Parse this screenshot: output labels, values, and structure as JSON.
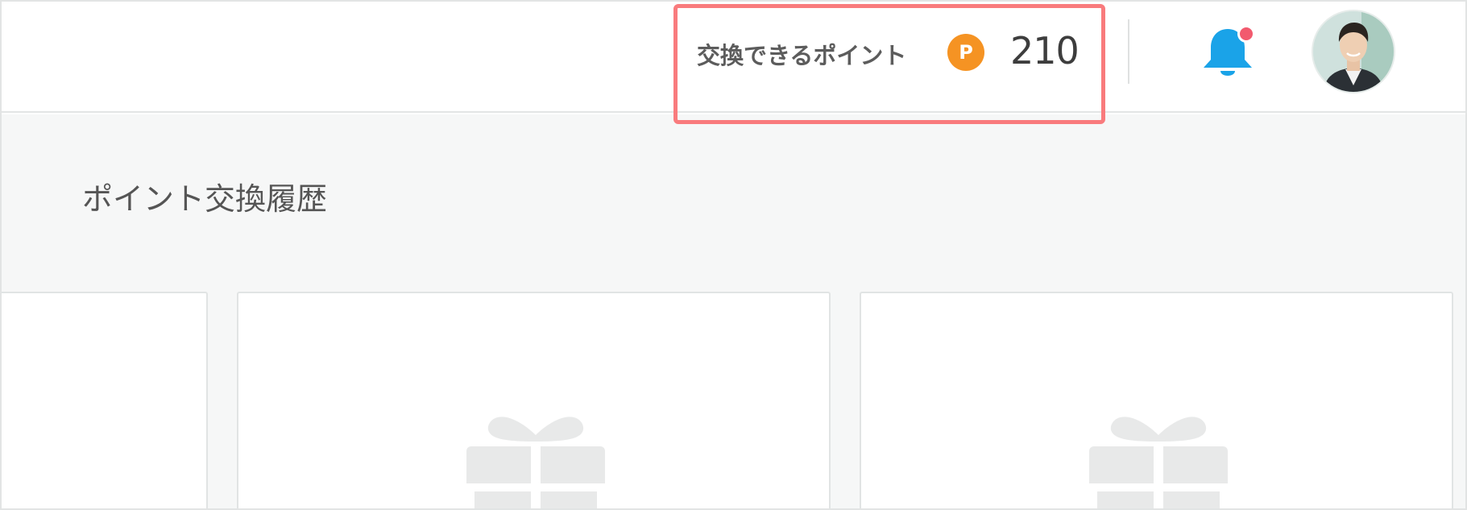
{
  "header": {
    "points_label": "交換できるポイント",
    "points_badge": "P",
    "points_value": "210",
    "notification_icon": "bell-icon",
    "avatar_alt": "user avatar"
  },
  "page": {
    "title": "ポイント交換履歴"
  },
  "cards": [
    {
      "icon": "none"
    },
    {
      "icon": "gift-icon"
    },
    {
      "icon": "gift-icon"
    }
  ],
  "colors": {
    "highlight_border": "#f97b7d",
    "points_badge": "#f59323",
    "bell": "#1aa3e8",
    "notification_dot": "#f25a6e",
    "main_background": "#f6f7f7",
    "gift_placeholder": "#e8e9e9"
  }
}
